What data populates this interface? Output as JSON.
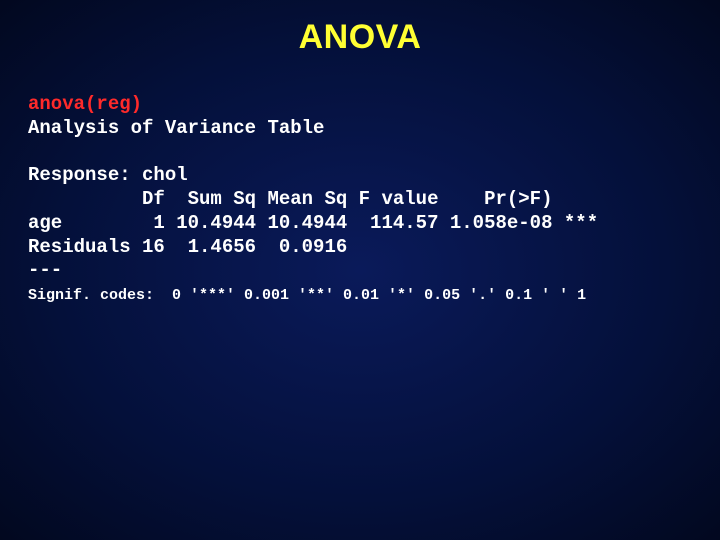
{
  "title": "ANOVA",
  "command": "anova(reg)",
  "heading_line": "Analysis of Variance Table",
  "response_line": "Response: chol",
  "header_row": "          Df  Sum Sq Mean Sq F value    Pr(>F)",
  "row_age": "age        1 10.4944 10.4944  114.57 1.058e-08 ***",
  "row_resid": "Residuals 16  1.4656  0.0916",
  "dashes": "---",
  "signif_line": "Signif. codes:  0 '***' 0.001 '**' 0.01 '*' 0.05 '.' 0.1 ' ' 1",
  "chart_data": {
    "type": "table",
    "title": "ANOVA — Analysis of Variance Table",
    "response": "chol",
    "columns": [
      "Df",
      "Sum Sq",
      "Mean Sq",
      "F value",
      "Pr(>F)",
      "Signif"
    ],
    "rows": [
      {
        "term": "age",
        "Df": 1,
        "Sum Sq": 10.4944,
        "Mean Sq": 10.4944,
        "F value": 114.57,
        "Pr(>F)": 1.058e-08,
        "Signif": "***"
      },
      {
        "term": "Residuals",
        "Df": 16,
        "Sum Sq": 1.4656,
        "Mean Sq": 0.0916,
        "F value": null,
        "Pr(>F)": null,
        "Signif": ""
      }
    ],
    "signif_codes": "0 '***' 0.001 '**' 0.01 '*' 0.05 '.' 0.1 ' ' 1"
  }
}
